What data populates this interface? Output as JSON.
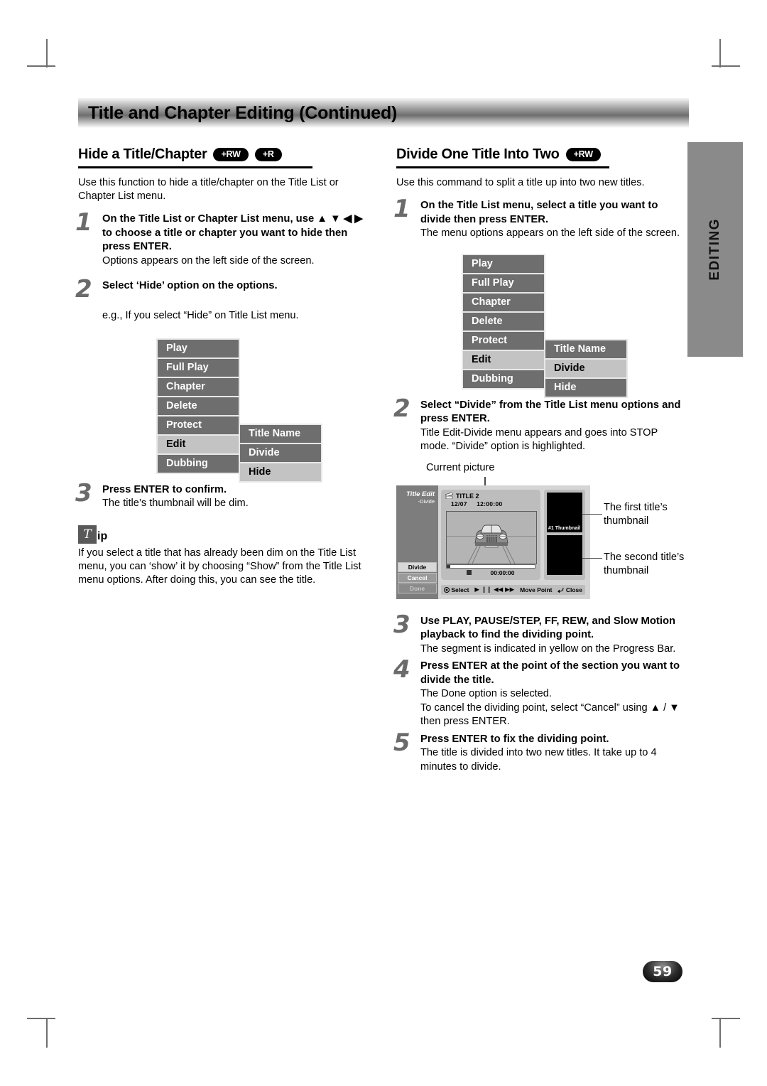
{
  "banner": {
    "title": "Title and Chapter Editing (Continued)"
  },
  "side_tab": {
    "label": "EDITING"
  },
  "page_number": "59",
  "left": {
    "heading": "Hide a Title/Chapter",
    "badges": [
      "+RW",
      "+R"
    ],
    "intro": "Use this function to hide a title/chapter on the Title List or Chapter List menu.",
    "steps": [
      {
        "num": "1",
        "head": "On the Title List or Chapter List menu, use ▲ ▼ ◀ ▶ to choose a title or chapter you want to hide then press ENTER.",
        "sub": "Options appears on the left side of the screen."
      },
      {
        "num": "2",
        "head": "Select ‘Hide’ option on the options.",
        "sub": ""
      },
      {
        "num": "3",
        "head": "Press ENTER to confirm.",
        "sub": "The title’s thumbnail will be dim."
      }
    ],
    "eg_text": "e.g., If you select “Hide” on Title List menu.",
    "menu": {
      "main": [
        {
          "label": "Play",
          "selected": false
        },
        {
          "label": "Full Play",
          "selected": false
        },
        {
          "label": "Chapter",
          "selected": false
        },
        {
          "label": "Delete",
          "selected": false
        },
        {
          "label": "Protect",
          "selected": false
        },
        {
          "label": "Edit",
          "selected": true
        },
        {
          "label": "Dubbing",
          "selected": false
        }
      ],
      "sub": [
        {
          "label": "Title Name",
          "selected": false
        },
        {
          "label": "Divide",
          "selected": false
        },
        {
          "label": "Hide",
          "selected": true
        }
      ]
    },
    "tip": {
      "badge": "T",
      "word": "ip",
      "text": "If you select a title that has already been dim on the Title List menu, you can ‘show’ it by choosing “Show” from the Title List menu options. After doing this, you can see the title."
    }
  },
  "right": {
    "heading": "Divide One Title Into Two",
    "badges": [
      "+RW"
    ],
    "intro": "Use this command to split a title up into two new titles.",
    "steps": [
      {
        "num": "1",
        "head": "On the Title List menu, select a title you want to divide then press ENTER.",
        "sub": "The menu options appears on the left side of the screen."
      },
      {
        "num": "2",
        "head": "Select “Divide” from the Title List menu options and press ENTER.",
        "sub": "Title Edit-Divide menu appears and goes into STOP mode. “Divide” option is highlighted."
      },
      {
        "num": "3",
        "head": "Use PLAY, PAUSE/STEP, FF, REW, and Slow Motion playback to find the dividing point.",
        "sub": "The segment is indicated in yellow on the Progress Bar."
      },
      {
        "num": "4",
        "head": "Press ENTER at the point of the section you want to divide the title.",
        "sub": "The Done option is selected.",
        "sub2": "To cancel the dividing point, select “Cancel” using ▲ / ▼ then press ENTER."
      },
      {
        "num": "5",
        "head": "Press ENTER to fix the dividing point.",
        "sub": "The title is divided into two new titles. It take up to 4 minutes to divide."
      }
    ],
    "menu": {
      "main": [
        {
          "label": "Play",
          "selected": false
        },
        {
          "label": "Full Play",
          "selected": false
        },
        {
          "label": "Chapter",
          "selected": false
        },
        {
          "label": "Delete",
          "selected": false
        },
        {
          "label": "Protect",
          "selected": false
        },
        {
          "label": "Edit",
          "selected": true
        },
        {
          "label": "Dubbing",
          "selected": false
        }
      ],
      "sub": [
        {
          "label": "Title Name",
          "selected": false
        },
        {
          "label": "Divide",
          "selected": true
        },
        {
          "label": "Hide",
          "selected": false
        }
      ]
    },
    "osd": {
      "panel_title": "Title Edit",
      "panel_sub": "-Divide",
      "buttons": [
        {
          "label": "Divide",
          "state": "highlighted"
        },
        {
          "label": "Cancel",
          "state": "normal"
        },
        {
          "label": "Done",
          "state": "dim"
        }
      ],
      "title_label": "TITLE 2",
      "date": "12/07",
      "time": "12:00:00",
      "counter": "00:00:00",
      "thumb1_label": "#1 Thumbnail",
      "toolbar": {
        "select": "Select",
        "transport": "▶  ❙❙  ◀◀  ▶▶",
        "move_point": "Move Point",
        "close": "Close"
      }
    },
    "callouts": {
      "current_picture": "Current picture",
      "first_thumb": "The first title’s thumbnail",
      "second_thumb": "The second title’s thumbnail"
    }
  }
}
